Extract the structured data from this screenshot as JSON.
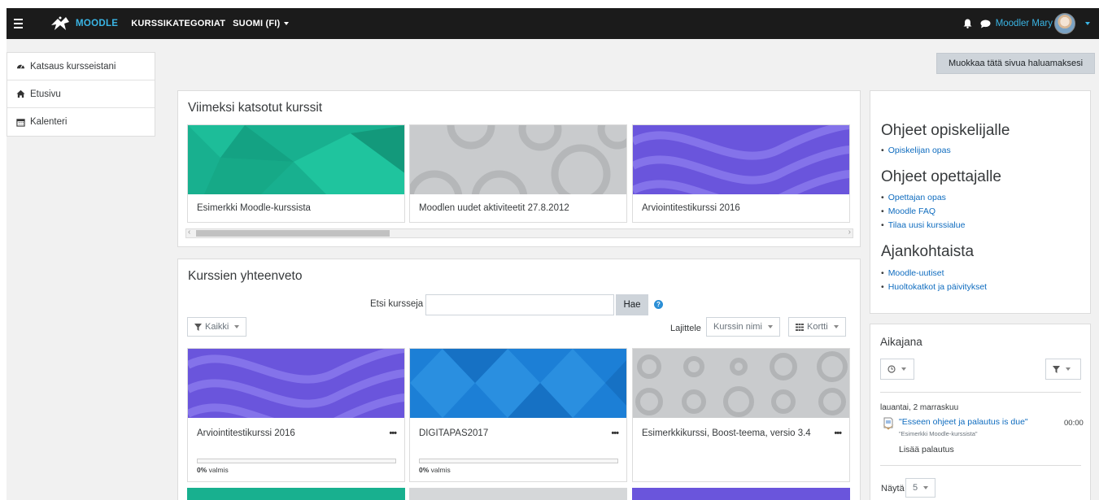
{
  "topbar": {
    "logo_text": "MOODLE",
    "nav": [
      {
        "label": "KURSSIKATEGORIAT"
      },
      {
        "label": "SUOMI (FI)"
      }
    ],
    "user_name": "Moodler Mary"
  },
  "sidebar": {
    "items": [
      {
        "label": "Katsaus kursseistani",
        "icon": "dashboard-icon"
      },
      {
        "label": "Etusivu",
        "icon": "home-icon"
      },
      {
        "label": "Kalenteri",
        "icon": "calendar-icon"
      }
    ]
  },
  "edit_page_button": "Muokkaa tätä sivua haluamaksesi",
  "recent": {
    "title": "Viimeksi katsotut kurssit",
    "courses": [
      {
        "name": "Esimerkki Moodle-kurssista",
        "color": "#1bb290"
      },
      {
        "name": "Moodlen uudet aktiviteetit 27.8.2012",
        "color": "#c8cacc"
      },
      {
        "name": "Arviointitestikurssi 2016",
        "color": "#6a55dc"
      }
    ]
  },
  "overview": {
    "title": "Kurssien yhteenveto",
    "search_label": "Etsi kursseja",
    "search_value": "",
    "search_button": "Hae",
    "help_icon": "?",
    "filter_label": "Kaikki",
    "sort_label": "Lajittele",
    "sort_value": "Kurssin nimi",
    "view_value": "Kortti",
    "courses": [
      {
        "name": "Arviointitestikurssi 2016",
        "progress_pct": "0%",
        "progress_text": "valmis",
        "color": "#6a55dc"
      },
      {
        "name": "DIGITAPAS2017",
        "progress_pct": "0%",
        "progress_text": "valmis",
        "color": "#1c7fd6"
      },
      {
        "name": "Esimerkkikurssi, Boost-teema, versio 3.4",
        "color": "#c8cacc"
      }
    ],
    "dots": "•••"
  },
  "help_block": {
    "sections": [
      {
        "heading": "Ohjeet opiskelijalle",
        "links": [
          "Opiskelijan opas"
        ]
      },
      {
        "heading": "Ohjeet opettajalle",
        "links": [
          "Opettajan opas",
          "Moodle FAQ",
          "Tilaa uusi kurssialue"
        ]
      },
      {
        "heading": "Ajankohtaista",
        "links": [
          "Moodle-uutiset",
          "Huoltokatkot ja päivitykset"
        ]
      }
    ],
    "bullet": "•"
  },
  "timeline": {
    "title": "Aikajana",
    "date": "lauantai, 2 marraskuu",
    "event_title": "\"Esseen ohjeet ja palautus is due\"",
    "event_course": "\"Esimerkki Moodle-kurssista\"",
    "event_time": "00:00",
    "event_action": "Lisää palautus",
    "show_label": "Näytä",
    "show_value": "5"
  }
}
